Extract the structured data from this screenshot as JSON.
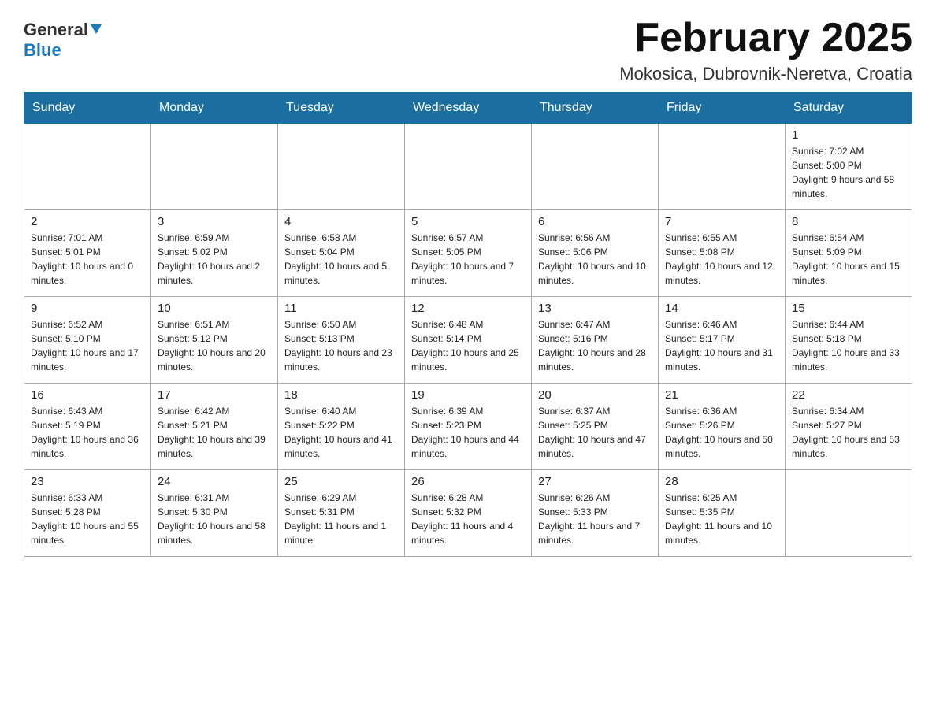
{
  "header": {
    "logo_general": "General",
    "logo_blue": "Blue",
    "title": "February 2025",
    "subtitle": "Mokosica, Dubrovnik-Neretva, Croatia"
  },
  "days_of_week": [
    "Sunday",
    "Monday",
    "Tuesday",
    "Wednesday",
    "Thursday",
    "Friday",
    "Saturday"
  ],
  "weeks": [
    [
      {
        "day": "",
        "info": ""
      },
      {
        "day": "",
        "info": ""
      },
      {
        "day": "",
        "info": ""
      },
      {
        "day": "",
        "info": ""
      },
      {
        "day": "",
        "info": ""
      },
      {
        "day": "",
        "info": ""
      },
      {
        "day": "1",
        "info": "Sunrise: 7:02 AM\nSunset: 5:00 PM\nDaylight: 9 hours and 58 minutes."
      }
    ],
    [
      {
        "day": "2",
        "info": "Sunrise: 7:01 AM\nSunset: 5:01 PM\nDaylight: 10 hours and 0 minutes."
      },
      {
        "day": "3",
        "info": "Sunrise: 6:59 AM\nSunset: 5:02 PM\nDaylight: 10 hours and 2 minutes."
      },
      {
        "day": "4",
        "info": "Sunrise: 6:58 AM\nSunset: 5:04 PM\nDaylight: 10 hours and 5 minutes."
      },
      {
        "day": "5",
        "info": "Sunrise: 6:57 AM\nSunset: 5:05 PM\nDaylight: 10 hours and 7 minutes."
      },
      {
        "day": "6",
        "info": "Sunrise: 6:56 AM\nSunset: 5:06 PM\nDaylight: 10 hours and 10 minutes."
      },
      {
        "day": "7",
        "info": "Sunrise: 6:55 AM\nSunset: 5:08 PM\nDaylight: 10 hours and 12 minutes."
      },
      {
        "day": "8",
        "info": "Sunrise: 6:54 AM\nSunset: 5:09 PM\nDaylight: 10 hours and 15 minutes."
      }
    ],
    [
      {
        "day": "9",
        "info": "Sunrise: 6:52 AM\nSunset: 5:10 PM\nDaylight: 10 hours and 17 minutes."
      },
      {
        "day": "10",
        "info": "Sunrise: 6:51 AM\nSunset: 5:12 PM\nDaylight: 10 hours and 20 minutes."
      },
      {
        "day": "11",
        "info": "Sunrise: 6:50 AM\nSunset: 5:13 PM\nDaylight: 10 hours and 23 minutes."
      },
      {
        "day": "12",
        "info": "Sunrise: 6:48 AM\nSunset: 5:14 PM\nDaylight: 10 hours and 25 minutes."
      },
      {
        "day": "13",
        "info": "Sunrise: 6:47 AM\nSunset: 5:16 PM\nDaylight: 10 hours and 28 minutes."
      },
      {
        "day": "14",
        "info": "Sunrise: 6:46 AM\nSunset: 5:17 PM\nDaylight: 10 hours and 31 minutes."
      },
      {
        "day": "15",
        "info": "Sunrise: 6:44 AM\nSunset: 5:18 PM\nDaylight: 10 hours and 33 minutes."
      }
    ],
    [
      {
        "day": "16",
        "info": "Sunrise: 6:43 AM\nSunset: 5:19 PM\nDaylight: 10 hours and 36 minutes."
      },
      {
        "day": "17",
        "info": "Sunrise: 6:42 AM\nSunset: 5:21 PM\nDaylight: 10 hours and 39 minutes."
      },
      {
        "day": "18",
        "info": "Sunrise: 6:40 AM\nSunset: 5:22 PM\nDaylight: 10 hours and 41 minutes."
      },
      {
        "day": "19",
        "info": "Sunrise: 6:39 AM\nSunset: 5:23 PM\nDaylight: 10 hours and 44 minutes."
      },
      {
        "day": "20",
        "info": "Sunrise: 6:37 AM\nSunset: 5:25 PM\nDaylight: 10 hours and 47 minutes."
      },
      {
        "day": "21",
        "info": "Sunrise: 6:36 AM\nSunset: 5:26 PM\nDaylight: 10 hours and 50 minutes."
      },
      {
        "day": "22",
        "info": "Sunrise: 6:34 AM\nSunset: 5:27 PM\nDaylight: 10 hours and 53 minutes."
      }
    ],
    [
      {
        "day": "23",
        "info": "Sunrise: 6:33 AM\nSunset: 5:28 PM\nDaylight: 10 hours and 55 minutes."
      },
      {
        "day": "24",
        "info": "Sunrise: 6:31 AM\nSunset: 5:30 PM\nDaylight: 10 hours and 58 minutes."
      },
      {
        "day": "25",
        "info": "Sunrise: 6:29 AM\nSunset: 5:31 PM\nDaylight: 11 hours and 1 minute."
      },
      {
        "day": "26",
        "info": "Sunrise: 6:28 AM\nSunset: 5:32 PM\nDaylight: 11 hours and 4 minutes."
      },
      {
        "day": "27",
        "info": "Sunrise: 6:26 AM\nSunset: 5:33 PM\nDaylight: 11 hours and 7 minutes."
      },
      {
        "day": "28",
        "info": "Sunrise: 6:25 AM\nSunset: 5:35 PM\nDaylight: 11 hours and 10 minutes."
      },
      {
        "day": "",
        "info": ""
      }
    ]
  ]
}
